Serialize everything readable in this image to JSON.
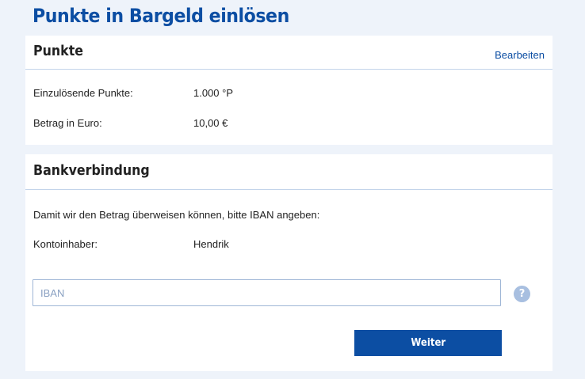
{
  "page": {
    "title": "Punkte in Bargeld einlösen"
  },
  "points_section": {
    "title": "Punkte",
    "edit_label": "Bearbeiten",
    "rows": [
      {
        "label": "Einzulösende Punkte:",
        "value": "1.000 °P"
      },
      {
        "label": "Betrag in Euro:",
        "value": "10,00 €"
      }
    ]
  },
  "bank_section": {
    "title": "Bankverbindung",
    "intro": "Damit wir den Betrag überweisen können, bitte IBAN angeben:",
    "holder_label": "Kontoinhaber:",
    "holder_value": "Hendrik",
    "iban": {
      "placeholder": "IBAN",
      "value": ""
    },
    "help_icon_glyph": "?",
    "submit_label": "Weiter"
  },
  "colors": {
    "background": "#eef3fa",
    "brand_blue": "#0c4ea3",
    "divider": "#c3d4ea",
    "help_icon": "#a8bfe0"
  },
  "icons": {
    "help": "question-circle-icon"
  }
}
